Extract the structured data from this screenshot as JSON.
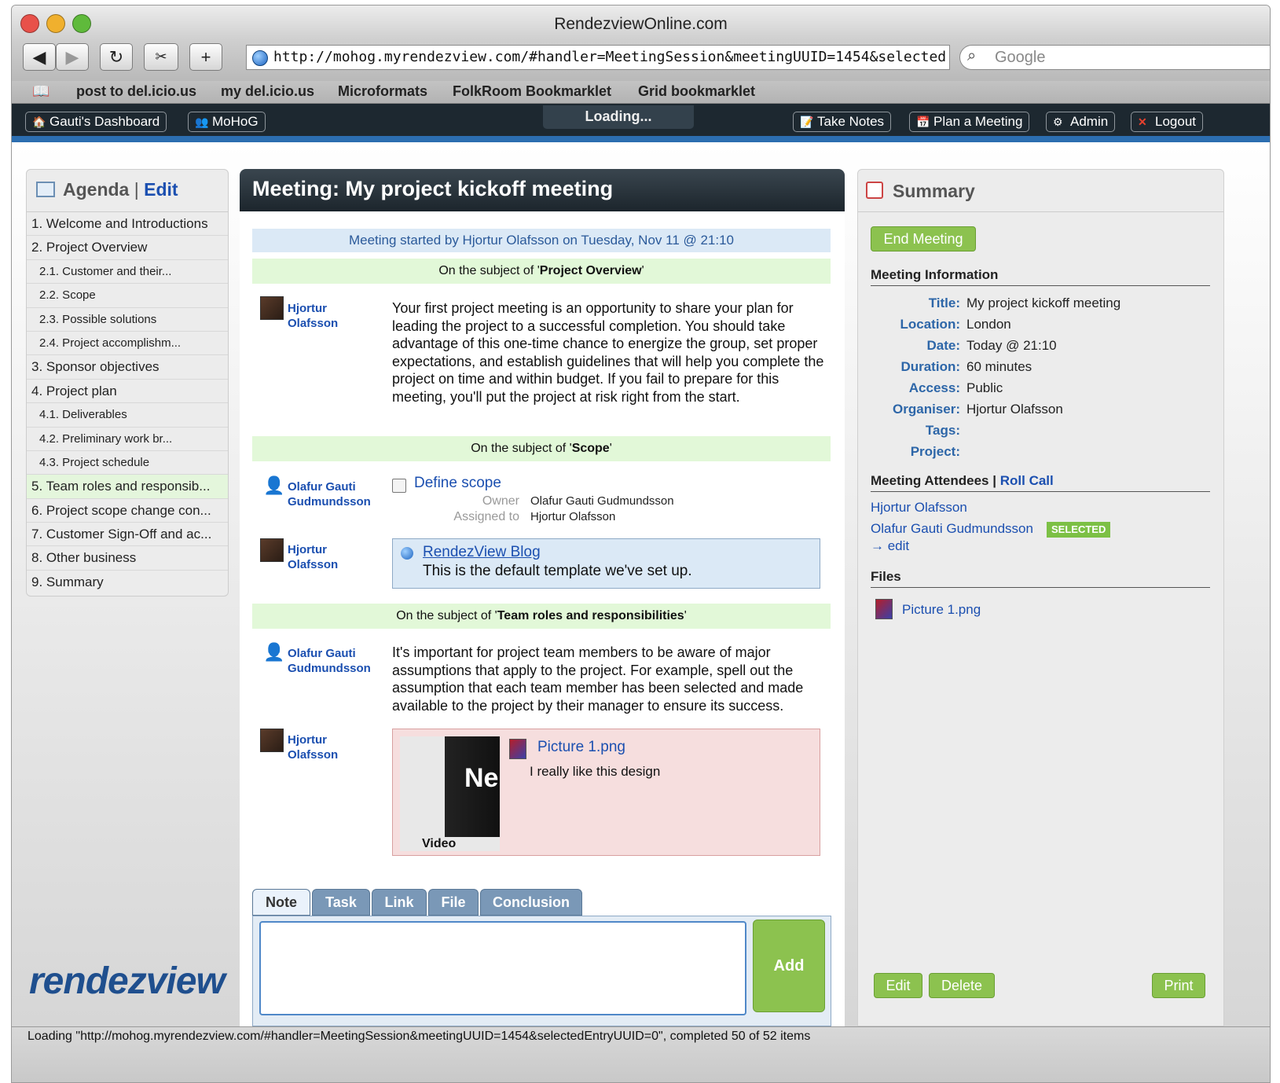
{
  "browser": {
    "title": "RendezviewOnline.com",
    "url": "http://mohog.myrendezview.com/#handler=MeetingSession&meetingUUID=1454&selected",
    "search_placeholder": "Google",
    "bookmarks": [
      "post to del.icio.us",
      "my del.icio.us",
      "Microformats",
      "FolkRoom Bookmarklet",
      "Grid bookmarklet"
    ],
    "status": "Loading \"http://mohog.myrendezview.com/#handler=MeetingSession&meetingUUID=1454&selectedEntryUUID=0\", completed 50 of 52 items"
  },
  "appbar": {
    "dashboard": "Gauti's Dashboard",
    "mohog": "MoHoG",
    "loading": "Loading...",
    "take_notes": "Take Notes",
    "plan_meeting": "Plan a Meeting",
    "admin": "Admin",
    "logout": "Logout"
  },
  "agenda": {
    "title": "Agenda",
    "sep": "|",
    "edit": "Edit",
    "items": [
      "1. Welcome and Introductions",
      "2. Project Overview",
      "2.1. Customer and their...",
      "2.2. Scope",
      "2.3. Possible solutions",
      "2.4. Project accomplishm...",
      "3. Sponsor objectives",
      "4. Project plan",
      "4.1. Deliverables",
      "4.2. Preliminary work br...",
      "4.3. Project schedule",
      "5. Team roles and responsib...",
      "6. Project scope change con...",
      "7. Customer Sign-Off and ac...",
      "8. Other business",
      "9. Summary"
    ]
  },
  "logo": "rendezview",
  "meeting": {
    "title": "Meeting: My project kickoff meeting",
    "started": "Meeting started by Hjortur Olafsson on Tuesday, Nov 11 @ 21:10",
    "subj_prefix": "On the subject of '",
    "subj_suffix": "'",
    "subject1": "Project Overview",
    "subject2": "Scope",
    "subject3": "Team roles and responsibilities",
    "hjortur_1": "Hjortur",
    "hjortur_2": "Olafsson",
    "olafur_1": "Olafur Gauti",
    "olafur_2": "Gudmundsson",
    "note1": "Your first project meeting is an opportunity to share your plan for leading the project to a successful completion. You should take advantage of this one-time chance to energize the group, set proper expectations, and establish guidelines that will help you complete the project on time and within budget. If you fail to prepare for this meeting, you'll put the project at risk right from the start.",
    "task_title": "Define scope",
    "owner_label": "Owner",
    "owner_value": "Olafur Gauti Gudmundsson",
    "assigned_label": "Assigned to",
    "assigned_value": "Hjortur Olafsson",
    "link_title": "RendezView Blog",
    "link_desc": "This is the default template we've set up.",
    "note2": "It's important for project team members to be aware of major assumptions that apply to the project. For example, spell out the assumption that each team member has been selected and made available to the project by their manager to ensure its success.",
    "file_name": "Picture 1.png",
    "file_comment": "I really like this design",
    "thumb_text1": "Ne",
    "thumb_text2": "Video",
    "tabs": [
      "Note",
      "Task",
      "Link",
      "File",
      "Conclusion"
    ],
    "add": "Add"
  },
  "summary": {
    "title": "Summary",
    "end_meeting": "End Meeting",
    "info_header": "Meeting Information",
    "info": [
      {
        "label": "Title:",
        "value": "My project kickoff meeting"
      },
      {
        "label": "Location:",
        "value": "London"
      },
      {
        "label": "Date:",
        "value": "Today @ 21:10"
      },
      {
        "label": "Duration:",
        "value": "60 minutes"
      },
      {
        "label": "Access:",
        "value": "Public"
      },
      {
        "label": "Organiser:",
        "value": "Hjortur Olafsson"
      },
      {
        "label": "Tags:",
        "value": ""
      },
      {
        "label": "Project:",
        "value": ""
      }
    ],
    "attendees_header": "Meeting Attendees",
    "sep": "|",
    "roll_call": "Roll Call",
    "attendee1": "Hjortur Olafsson",
    "attendee2": "Olafur Gauti Gudmundsson",
    "selected_badge": "SELECTED",
    "edit_link": "→ edit",
    "files_header": "Files",
    "file1": "Picture 1.png",
    "edit": "Edit",
    "delete": "Delete",
    "print": "Print"
  },
  "colors": {
    "accent": "#1b4fb0",
    "green": "#8cc24f",
    "appbar": "#1d2830"
  }
}
